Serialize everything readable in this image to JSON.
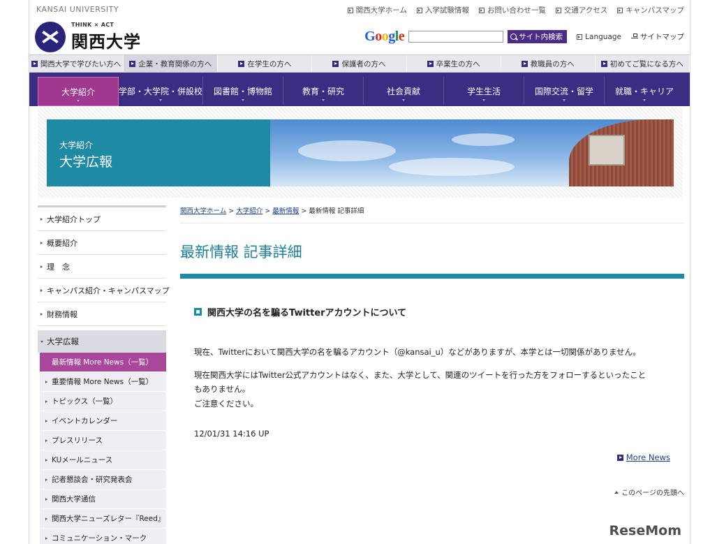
{
  "header": {
    "univ_en": "KANSAI UNIVERSITY",
    "top_links": [
      "関西大学ホーム",
      "入学試験情報",
      "お問い合わせ一覧",
      "交通アクセス",
      "キャンパスマップ"
    ],
    "tagline": "THINK × ACT",
    "logo_text": "関西大学",
    "search_logo": "Google",
    "search_placeholder": "",
    "search_button": "サイト内検索",
    "language": "Language",
    "sitemap": "サイトマップ"
  },
  "audience_nav": [
    "関西大学で学びたい方へ",
    "企業・教育関係の方へ",
    "在学生の方へ",
    "保護者の方へ",
    "卒業生の方へ",
    "教職員の方へ",
    "初めてご覧になる方へ"
  ],
  "audience_active": 1,
  "main_nav": [
    "大学紹介",
    "学部・大学院・併設校",
    "図書館・博物館",
    "教育・研究",
    "社会貢献",
    "学生生活",
    "国際交流・留学",
    "就職・キャリア"
  ],
  "banner": {
    "sub": "大学紹介",
    "title": "大学広報"
  },
  "sidebar": {
    "items": [
      "大学紹介トップ",
      "概要紹介",
      "理　念",
      "キャンパス紹介・キャンパスマップ",
      "財務情報"
    ],
    "group": "大学広報",
    "subitems": [
      "最新情報 More News（一覧）",
      "重要情報 More News（一覧）",
      "トピックス（一覧）",
      "イベントカレンダー",
      "プレスリリース",
      "KUメールニュース",
      "記者懇談会・研究発表会",
      "関西大学通信",
      "関西大学ニューズレター『Reed』",
      "コミュニケーション・マーク"
    ]
  },
  "content": {
    "breadcrumb": {
      "home": "関西大学ホーム",
      "sep": ">",
      "intro": "大学紹介",
      "latest": "最新情報",
      "current": "最新情報 記事詳細"
    },
    "page_title": "最新情報 記事詳細",
    "article_title": "関西大学の名を騙るTwitterアカウントについて",
    "para1": "現在、Twitterにおいて関西大学の名を騙るアカウント（@kansai_u）などがありますが、本学とは一切関係がありません。",
    "para2_line1": "現在関西大学にはTwitter公式アカウントはなく、また、大学として、関連のツイートを行った方をフォローするといったこと",
    "para2_line2": "もありません。",
    "para2_line3": "ご注意ください。",
    "timestamp": "12/01/31 14:16 UP",
    "more_news": "More News",
    "to_top": "このページの先頭へ"
  },
  "watermark": {
    "part1": "Rese",
    "part2": "Mom"
  }
}
